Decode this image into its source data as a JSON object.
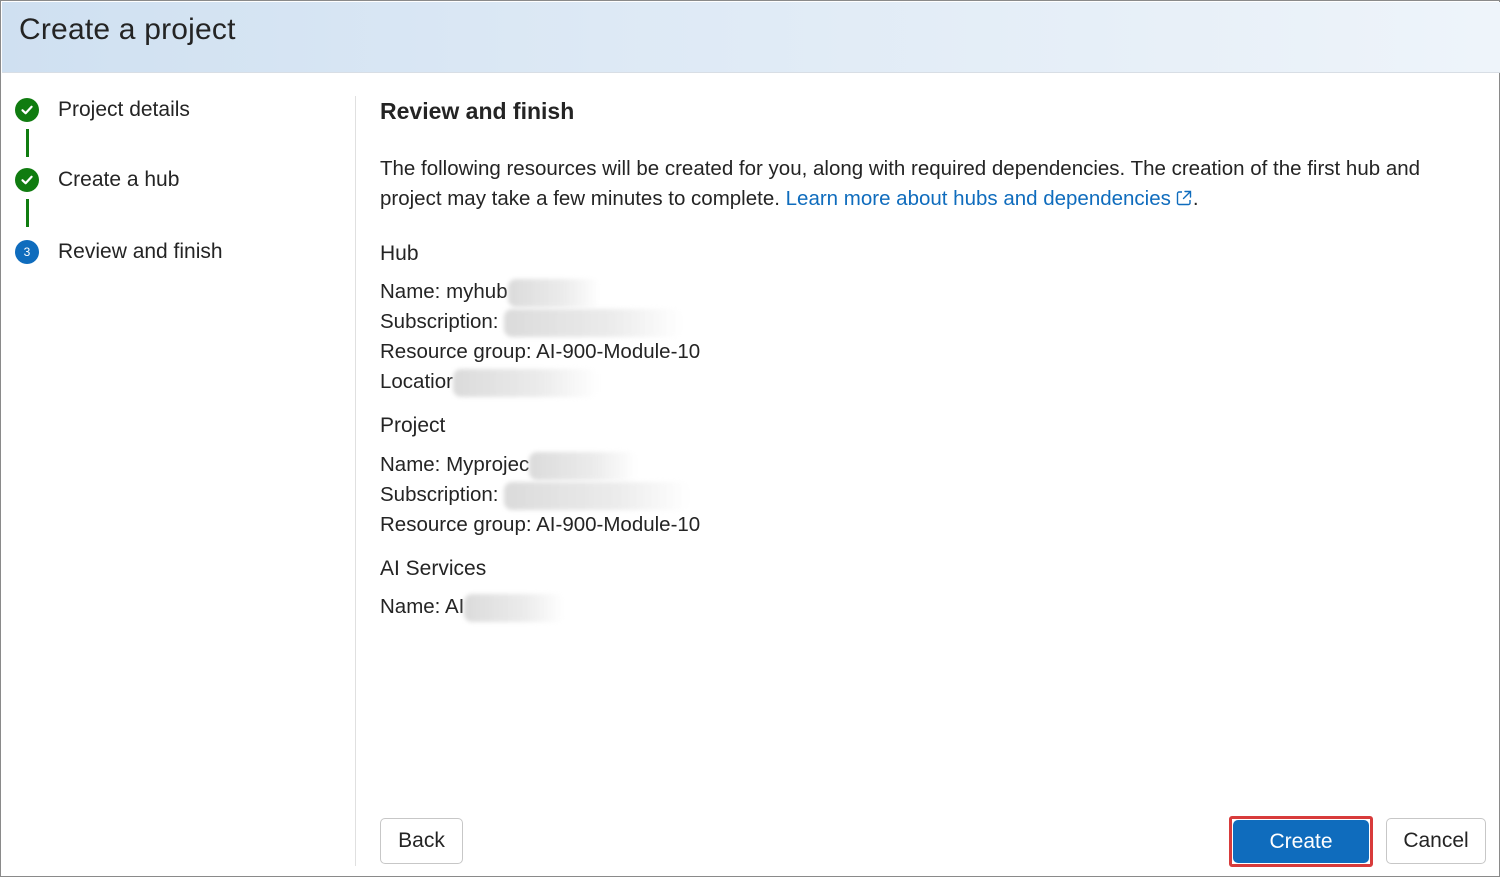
{
  "dialog": {
    "title": "Create a project"
  },
  "stepper": {
    "steps": [
      {
        "label": "Project details",
        "status": "completed"
      },
      {
        "label": "Create a hub",
        "status": "completed"
      },
      {
        "label": "Review and finish",
        "status": "current",
        "number": "3"
      }
    ]
  },
  "review": {
    "title": "Review and finish",
    "intro_text": "The following resources will be created for you, along with required dependencies. The creation of the first hub and project may take a few minutes to complete. ",
    "learn_more_link": "Learn more about hubs and dependencies",
    "intro_end": ".",
    "hub": {
      "heading": "Hub",
      "name_label": "Name: myhub",
      "subscription_label": "Subscription: ",
      "resource_group_label": "Resource group: AI-900-Module-10",
      "location_label": "Locatior"
    },
    "project": {
      "heading": "Project",
      "name_label": "Name: Myprojec",
      "subscription_label": "Subscription: ",
      "resource_group_label": "Resource group: AI-900-Module-10"
    },
    "ai_services": {
      "heading": "AI Services",
      "name_label": "Name: AI"
    }
  },
  "footer": {
    "back_label": "Back",
    "create_label": "Create",
    "cancel_label": "Cancel"
  },
  "colors": {
    "accent": "#0f6cbd",
    "success": "#107c10",
    "highlight": "#d83b3b"
  }
}
